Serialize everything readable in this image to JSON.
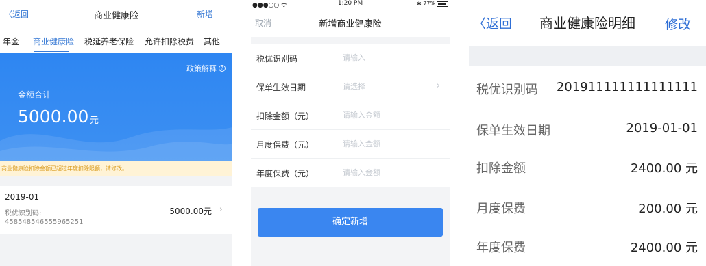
{
  "list_screen": {
    "nav": {
      "back_label": "返回",
      "title": "商业健康险",
      "add_label": "新增"
    },
    "tabs": [
      {
        "label": "年金",
        "active": false
      },
      {
        "label": "商业健康险",
        "active": true
      },
      {
        "label": "税延养老保险",
        "active": false
      },
      {
        "label": "允许扣除税费",
        "active": false
      },
      {
        "label": "其他",
        "active": false
      }
    ],
    "banner": {
      "policy_link": "政策解释",
      "help_symbol": "?",
      "total_label": "金额合计",
      "total_value": "5000.00",
      "total_unit": "元"
    },
    "warning": "商业健康险扣除金额已超过年度扣除限额，请修改。",
    "record": {
      "date": "2019-01",
      "id_label": "税优识别码:",
      "id_value": "458548546555965251",
      "amount": "5000.00元",
      "chevron": "›"
    }
  },
  "add_screen": {
    "status_bar": {
      "signal": "●●●○○ ᯤ",
      "time": "1:20 PM",
      "battery": "✱ 77%"
    },
    "nav": {
      "cancel_label": "取消",
      "title": "新增商业健康险"
    },
    "fields": [
      {
        "label": "税优识别码",
        "placeholder": "请输入",
        "has_chevron": false
      },
      {
        "label": "保单生效日期",
        "placeholder": "请选择",
        "has_chevron": true
      },
      {
        "label": "扣除金额（元）",
        "placeholder": "请输入金额",
        "has_chevron": false
      },
      {
        "label": "月度保费（元）",
        "placeholder": "请输入金额",
        "has_chevron": false
      },
      {
        "label": "年度保费（元）",
        "placeholder": "请输入金额",
        "has_chevron": false
      }
    ],
    "chevron": "›",
    "confirm_label": "确定新增"
  },
  "detail_screen": {
    "nav": {
      "back_label": "〈返回",
      "title": "商业健康险明细",
      "edit_label": "修改"
    },
    "rows": [
      {
        "label": "税优识别码",
        "value": "201911111111111111"
      },
      {
        "label": "保单生效日期",
        "value": "2019-01-01"
      },
      {
        "label": "扣除金额",
        "value": "2400.00 元"
      },
      {
        "label": "月度保费",
        "value": "200.00 元"
      },
      {
        "label": "年度保费",
        "value": "2400.00 元"
      }
    ]
  },
  "colors": {
    "accent": "#3a7bd5",
    "banner_blue": "#2e86f2",
    "warning_bg": "#fff3d6",
    "warning_text": "#d99a1a",
    "confirm_button": "#3a86f0"
  }
}
